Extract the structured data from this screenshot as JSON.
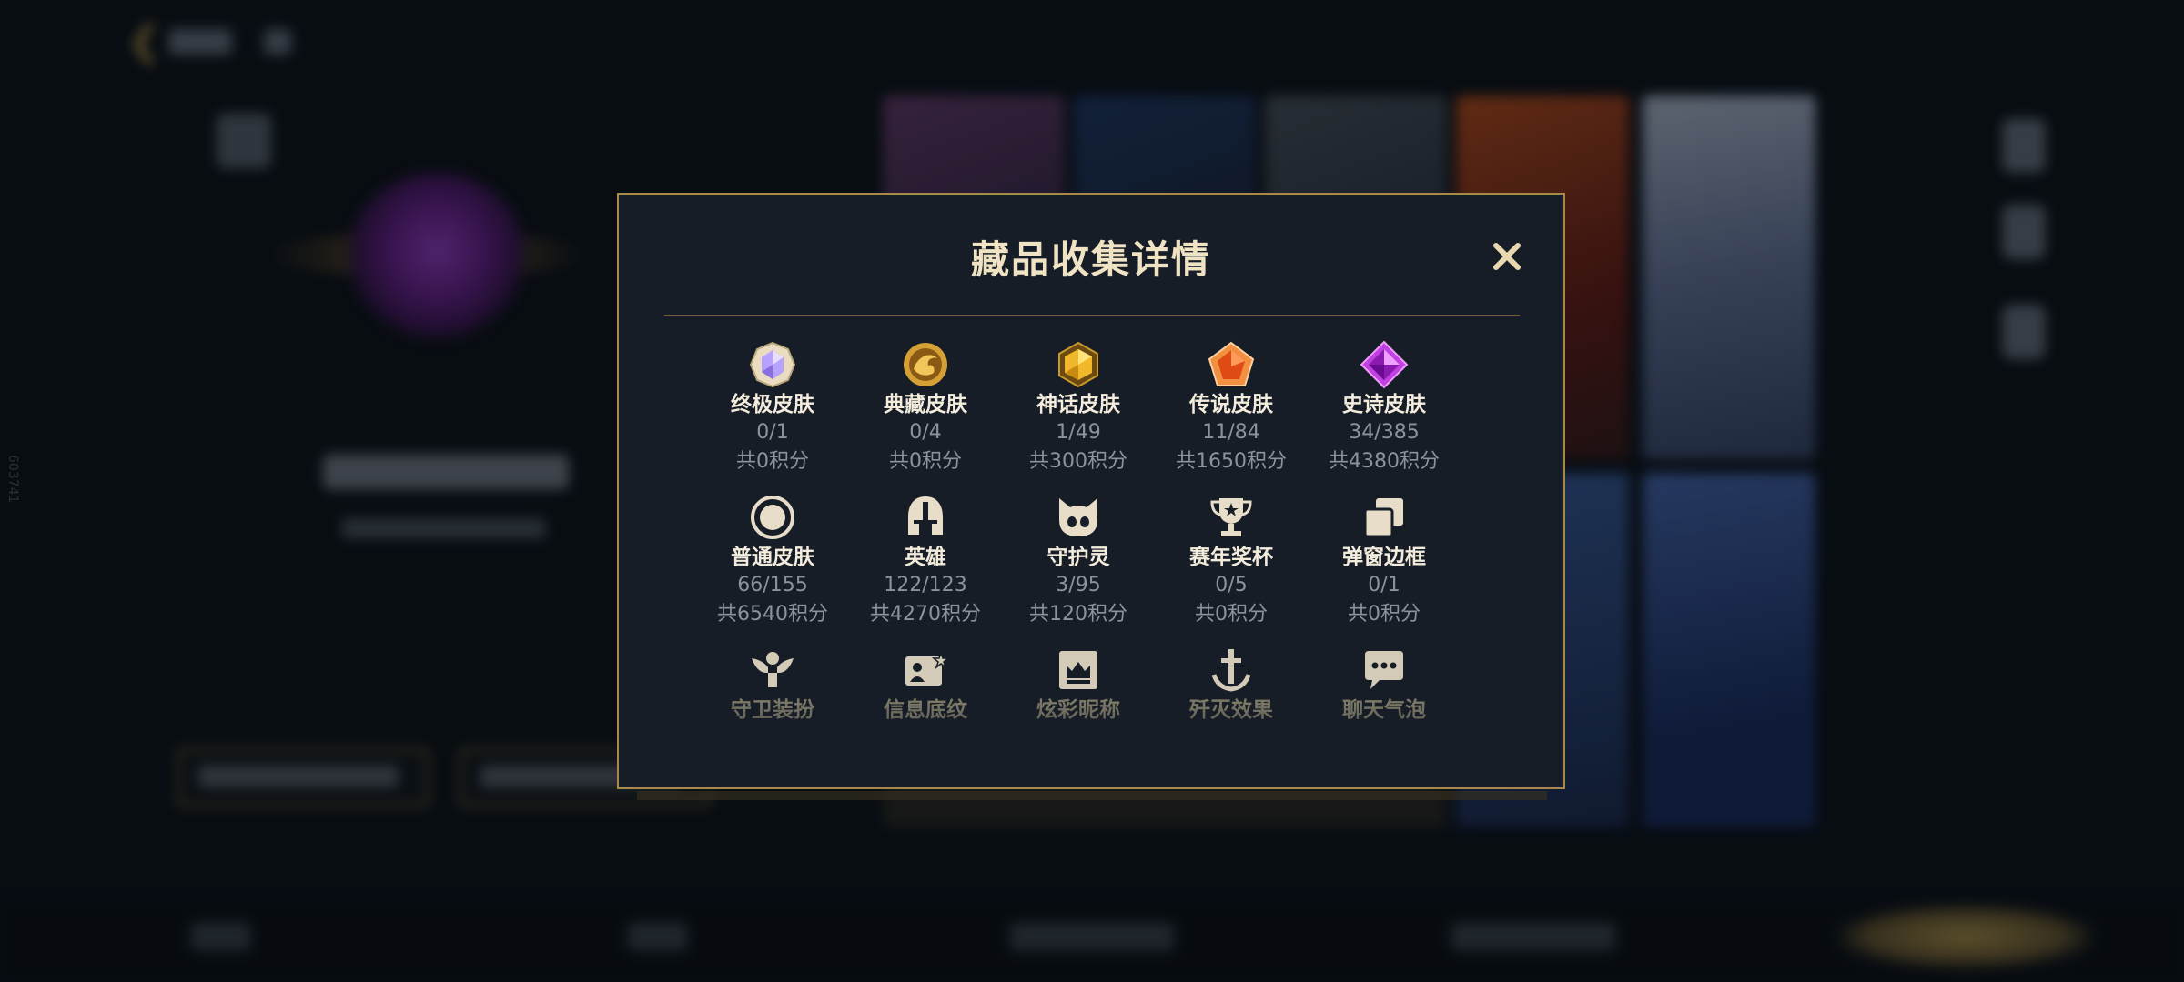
{
  "side_id": "603741",
  "modal": {
    "title": "藏品收集详情",
    "items": [
      {
        "name": "终极皮肤",
        "count": "0/1",
        "points": "共0积分",
        "icon": "ultimate-skin-icon"
      },
      {
        "name": "典藏皮肤",
        "count": "0/4",
        "points": "共0积分",
        "icon": "collection-skin-icon"
      },
      {
        "name": "神话皮肤",
        "count": "1/49",
        "points": "共300积分",
        "icon": "mythic-skin-icon"
      },
      {
        "name": "传说皮肤",
        "count": "11/84",
        "points": "共1650积分",
        "icon": "legend-skin-icon"
      },
      {
        "name": "史诗皮肤",
        "count": "34/385",
        "points": "共4380积分",
        "icon": "epic-skin-icon"
      },
      {
        "name": "普通皮肤",
        "count": "66/155",
        "points": "共6540积分",
        "icon": "normal-skin-icon"
      },
      {
        "name": "英雄",
        "count": "122/123",
        "points": "共4270积分",
        "icon": "hero-icon"
      },
      {
        "name": "守护灵",
        "count": "3/95",
        "points": "共120积分",
        "icon": "guardian-spirit-icon"
      },
      {
        "name": "赛年奖杯",
        "count": "0/5",
        "points": "共0积分",
        "icon": "season-trophy-icon"
      },
      {
        "name": "弹窗边框",
        "count": "0/1",
        "points": "共0积分",
        "icon": "popup-frame-icon"
      },
      {
        "name": "守卫装扮",
        "icon": "guard-outfit-icon"
      },
      {
        "name": "信息底纹",
        "icon": "info-background-icon"
      },
      {
        "name": "炫彩昵称",
        "icon": "colorful-nickname-icon"
      },
      {
        "name": "歼灭效果",
        "icon": "annihilation-effect-icon"
      },
      {
        "name": "聊天气泡",
        "icon": "chat-bubble-icon"
      }
    ]
  },
  "colors": {
    "gold": "#a8894a",
    "title": "#efe3c4",
    "panel": "#161d26"
  }
}
